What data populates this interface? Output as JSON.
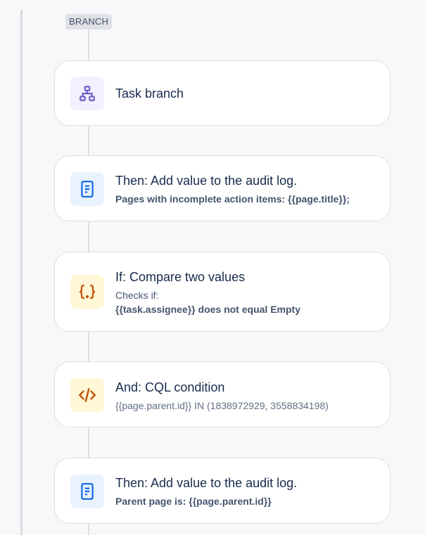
{
  "branch_tag": "BRANCH",
  "cards": [
    {
      "title": "Task branch",
      "icon": "tree-structure-icon"
    },
    {
      "title": "Then: Add value to the audit log.",
      "detail": "Pages with incomplete action items: {{page.title}};",
      "icon": "document-icon"
    },
    {
      "title": "If: Compare two values",
      "label": "Checks if:",
      "detail": "{{task.assignee}} does not equal Empty",
      "icon": "curly-braces-icon"
    },
    {
      "title": "And: CQL condition",
      "detail": "{{page.parent.id}} IN (1838972929, 3558834198)",
      "icon": "code-icon"
    },
    {
      "title": "Then: Add value to the audit log.",
      "detail": "Parent page is: {{page.parent.id}}",
      "icon": "document-icon"
    }
  ],
  "colors": {
    "purple_icon": "#6e5dc6",
    "blue_icon": "#0c66e4",
    "orange_icon": "#c25100"
  }
}
